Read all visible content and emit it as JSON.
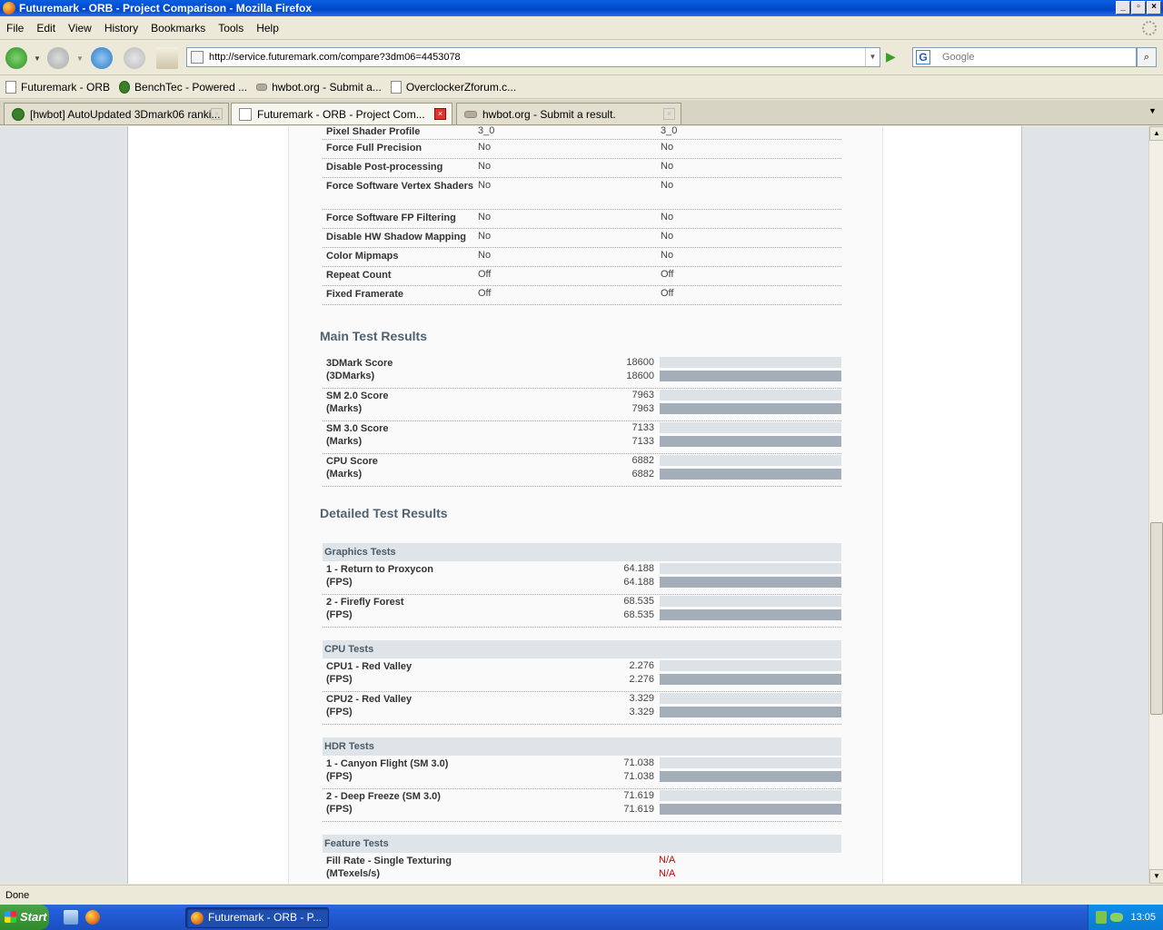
{
  "window": {
    "title": "Futuremark - ORB - Project Comparison - Mozilla Firefox"
  },
  "menu": [
    "File",
    "Edit",
    "View",
    "History",
    "Bookmarks",
    "Tools",
    "Help"
  ],
  "address": {
    "url": "http://service.futuremark.com/compare?3dm06=4453078"
  },
  "search": {
    "placeholder": "Google"
  },
  "bookmarks": [
    "Futuremark - ORB",
    "BenchTec - Powered ...",
    "hwbot.org - Submit a...",
    "OverclockerZforum.c..."
  ],
  "tabs": [
    {
      "label": "[hwbot] AutoUpdated 3Dmark06 ranki...",
      "active": false
    },
    {
      "label": "Futuremark - ORB - Project Com...",
      "active": true
    },
    {
      "label": "hwbot.org - Submit a result.",
      "active": false
    }
  ],
  "settings_rows": [
    {
      "label": "Pixel Shader Profile",
      "v1": "3_0",
      "v2": "3_0"
    },
    {
      "label": "Force Full Precision",
      "v1": "No",
      "v2": "No"
    },
    {
      "label": "Disable Post-processing",
      "v1": "No",
      "v2": "No"
    },
    {
      "label": "Force Software Vertex Shaders",
      "v1": "No",
      "v2": "No"
    },
    {
      "label": "Force Software FP Filtering",
      "v1": "No",
      "v2": "No"
    },
    {
      "label": "Disable HW Shadow Mapping",
      "v1": "No",
      "v2": "No"
    },
    {
      "label": "Color Mipmaps",
      "v1": "No",
      "v2": "No"
    },
    {
      "label": "Repeat Count",
      "v1": "Off",
      "v2": "Off"
    },
    {
      "label": "Fixed Framerate",
      "v1": "Off",
      "v2": "Off"
    }
  ],
  "main_results": {
    "title": "Main Test Results",
    "rows": [
      {
        "label": "3DMark Score",
        "unit": "(3DMarks)",
        "v1": "18600",
        "v2": "18600"
      },
      {
        "label": "SM 2.0 Score",
        "unit": "(Marks)",
        "v1": "7963",
        "v2": "7963"
      },
      {
        "label": "SM 3.0 Score",
        "unit": "(Marks)",
        "v1": "7133",
        "v2": "7133"
      },
      {
        "label": "CPU Score",
        "unit": "(Marks)",
        "v1": "6882",
        "v2": "6882"
      }
    ]
  },
  "detailed_results": {
    "title": "Detailed Test Results",
    "groups": [
      {
        "name": "Graphics Tests",
        "rows": [
          {
            "label": "1 - Return to Proxycon",
            "unit": "(FPS)",
            "v1": "64.188",
            "v2": "64.188"
          },
          {
            "label": "2 - Firefly Forest",
            "unit": "(FPS)",
            "v1": "68.535",
            "v2": "68.535"
          }
        ]
      },
      {
        "name": "CPU Tests",
        "rows": [
          {
            "label": "CPU1 - Red Valley",
            "unit": "(FPS)",
            "v1": "2.276",
            "v2": "2.276"
          },
          {
            "label": "CPU2 - Red Valley",
            "unit": "(FPS)",
            "v1": "3.329",
            "v2": "3.329"
          }
        ]
      },
      {
        "name": "HDR Tests",
        "rows": [
          {
            "label": "1 - Canyon Flight (SM 3.0)",
            "unit": "(FPS)",
            "v1": "71.038",
            "v2": "71.038"
          },
          {
            "label": "2 - Deep Freeze (SM 3.0)",
            "unit": "(FPS)",
            "v1": "71.619",
            "v2": "71.619"
          }
        ]
      },
      {
        "name": "Feature Tests",
        "rows": [
          {
            "label": "Fill Rate - Single Texturing",
            "unit": "(MTexels/s)",
            "v1": "N/A",
            "v2": "N/A"
          }
        ]
      }
    ]
  },
  "status": {
    "text": "Done"
  },
  "taskbar": {
    "start": "Start",
    "item": "Futuremark - ORB - P...",
    "clock": "13:05"
  }
}
